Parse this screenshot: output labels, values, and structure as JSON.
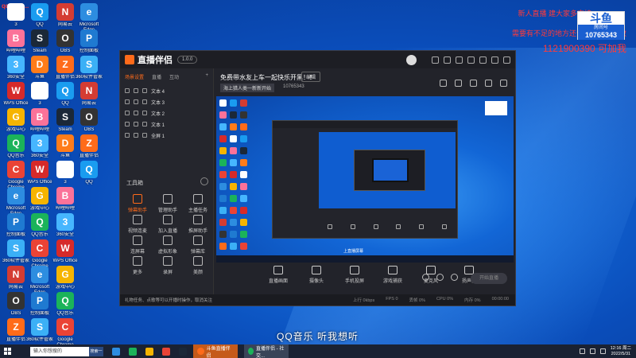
{
  "overlay": {
    "top_left_text": "qq1550...",
    "top_right_line1": "新人直播 建大家多支持",
    "top_right_line2": "需要有不足的地方还请大家多多指教",
    "top_right_line3": "1121900390 可加我",
    "logo_title": "斗鱼",
    "logo_sub": "房间号",
    "room_number": "10765343"
  },
  "desktop_icons": [
    {
      "label": "3",
      "color": "#ffffff",
      "glyph": "3"
    },
    {
      "label": "哔哩哔哩",
      "color": "#fb7299",
      "glyph": "B"
    },
    {
      "label": "360安全",
      "color": "#46b6ff",
      "glyph": "3"
    },
    {
      "label": "WPS Office",
      "color": "#d62a2a",
      "glyph": "W"
    },
    {
      "label": "游戏中心",
      "color": "#f6b400",
      "glyph": "G"
    },
    {
      "label": "QQ音乐",
      "color": "#1bb35a",
      "glyph": "Q"
    },
    {
      "label": "Google Chrome",
      "color": "#ea4335",
      "glyph": "C"
    },
    {
      "label": "Microsoft Edge",
      "color": "#2d8de0",
      "glyph": "e"
    },
    {
      "label": "控制面板",
      "color": "#1f7ad1",
      "glyph": "P"
    },
    {
      "label": "360软件管家",
      "color": "#3bb0f6",
      "glyph": "S"
    },
    {
      "label": "网易云",
      "color": "#d43c33",
      "glyph": "N"
    },
    {
      "label": "OBS",
      "color": "#333333",
      "glyph": "O"
    },
    {
      "label": "直播伴侣",
      "color": "#ff6b1a",
      "glyph": "Z"
    },
    {
      "label": "QQ",
      "color": "#1a9cf0",
      "glyph": "Q"
    },
    {
      "label": "Steam",
      "color": "#1b2838",
      "glyph": "S"
    },
    {
      "label": "斗鱼",
      "color": "#ff7c1a",
      "glyph": "D"
    }
  ],
  "app": {
    "logo": "直播伴侣",
    "version": "1.0.0",
    "tabs": [
      "场景设置",
      "直播",
      "互动"
    ],
    "sources": [
      "文本 4",
      "文本 3",
      "文本 2",
      "文本 1",
      "全屏 1"
    ],
    "toolbox_title": "工具箱",
    "tools": [
      "弹幕助手",
      "管理助手",
      "主播任务",
      "视频连麦",
      "加入直播",
      "推屏助手",
      "连屏幕",
      "虚拟形象",
      "弹幕库",
      "更多",
      "录屏",
      "美颜"
    ],
    "stream_title": "免费带水友上车一起快乐开黑！！",
    "edit_label": "编辑",
    "category": "海上猎人类一新新开始",
    "room_id_label": "10765343",
    "controls": [
      "直播画面",
      "摄像头",
      "手机投屏",
      "游戏捕获",
      "麦克风",
      "扬声器"
    ],
    "start_live": "开始直播",
    "status_tip": "礼物任务、点歌等可以开播时操作，取消关注",
    "stats": [
      "上行 0kbps",
      "FPS 0",
      "丢帧 0%",
      "CPU 0%",
      "内存 0%",
      "00:00:00"
    ]
  },
  "preview_caption": "上直播屏幕",
  "bottom_caption": "QQ音乐 听我想听",
  "taskbar": {
    "search_placeholder": "输入你想搜的",
    "search_button": "搜索一下",
    "apps": [
      {
        "label": "斗鱼直播伴侣",
        "color": "#ff6b1a"
      },
      {
        "label": "直播伴侣 - 社交...",
        "color": "#1bb35a"
      }
    ],
    "time": "12:16 周二",
    "date": "2022/5/31"
  }
}
